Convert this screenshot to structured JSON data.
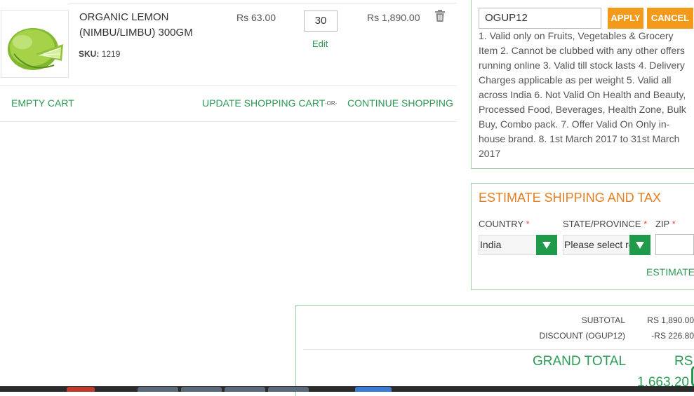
{
  "cart": {
    "item": {
      "name": "ORGANIC LEMON (NIMBU/LIMBU) 300GM",
      "sku_label": "SKU:",
      "sku": "1219",
      "price": "Rs 63.00",
      "qty": "30",
      "edit": "Edit",
      "subtotal": "Rs 1,890.00"
    },
    "actions": {
      "empty": "EMPTY CART",
      "update": "UPDATE SHOPPING CART",
      "or": "-OR-",
      "continue": "CONTINUE SHOPPING"
    }
  },
  "discount": {
    "code": "OGUP12",
    "apply": "APPLY",
    "cancel": "CANCEL",
    "terms": "1. Valid only on Fruits, Vegetables & Grocery Item 2. Cannot be clubbed with any other offers running online 3. Valid till stock lasts 4. Delivery Charges applicable as per weight 5. Valid all across India 6. Not Valid On Health and Beauty, Processed Food, Beverages, Health Zone, Bulk Buy, Combo pack. 7. Offer Valid On Only in-house brand. 8. 1st March 2017 to 31st March 2017"
  },
  "estimate": {
    "title": "ESTIMATE SHIPPING AND TAX",
    "country_label": "COUNTRY",
    "state_label": "STATE/PROVINCE",
    "zip_label": "ZIP",
    "required_mark": "*",
    "country_value": "India",
    "state_placeholder": "Please select region",
    "zip_value": "",
    "button": "ESTIMATE"
  },
  "totals": {
    "subtotal_label": "SUBTOTAL",
    "subtotal_value": "RS 1,890.00",
    "discount_label": "DISCOUNT (OGUP12)",
    "discount_value": "-RS 226.80",
    "grand_label": "GRAND TOTAL",
    "grand_currency": "RS",
    "grand_value": "1,663.20"
  },
  "colors": {
    "accent_green": "#2c9a54",
    "accent_orange": "#f49a1a",
    "heading_orange": "#e67e22",
    "panel_border": "#9bd1a7"
  }
}
